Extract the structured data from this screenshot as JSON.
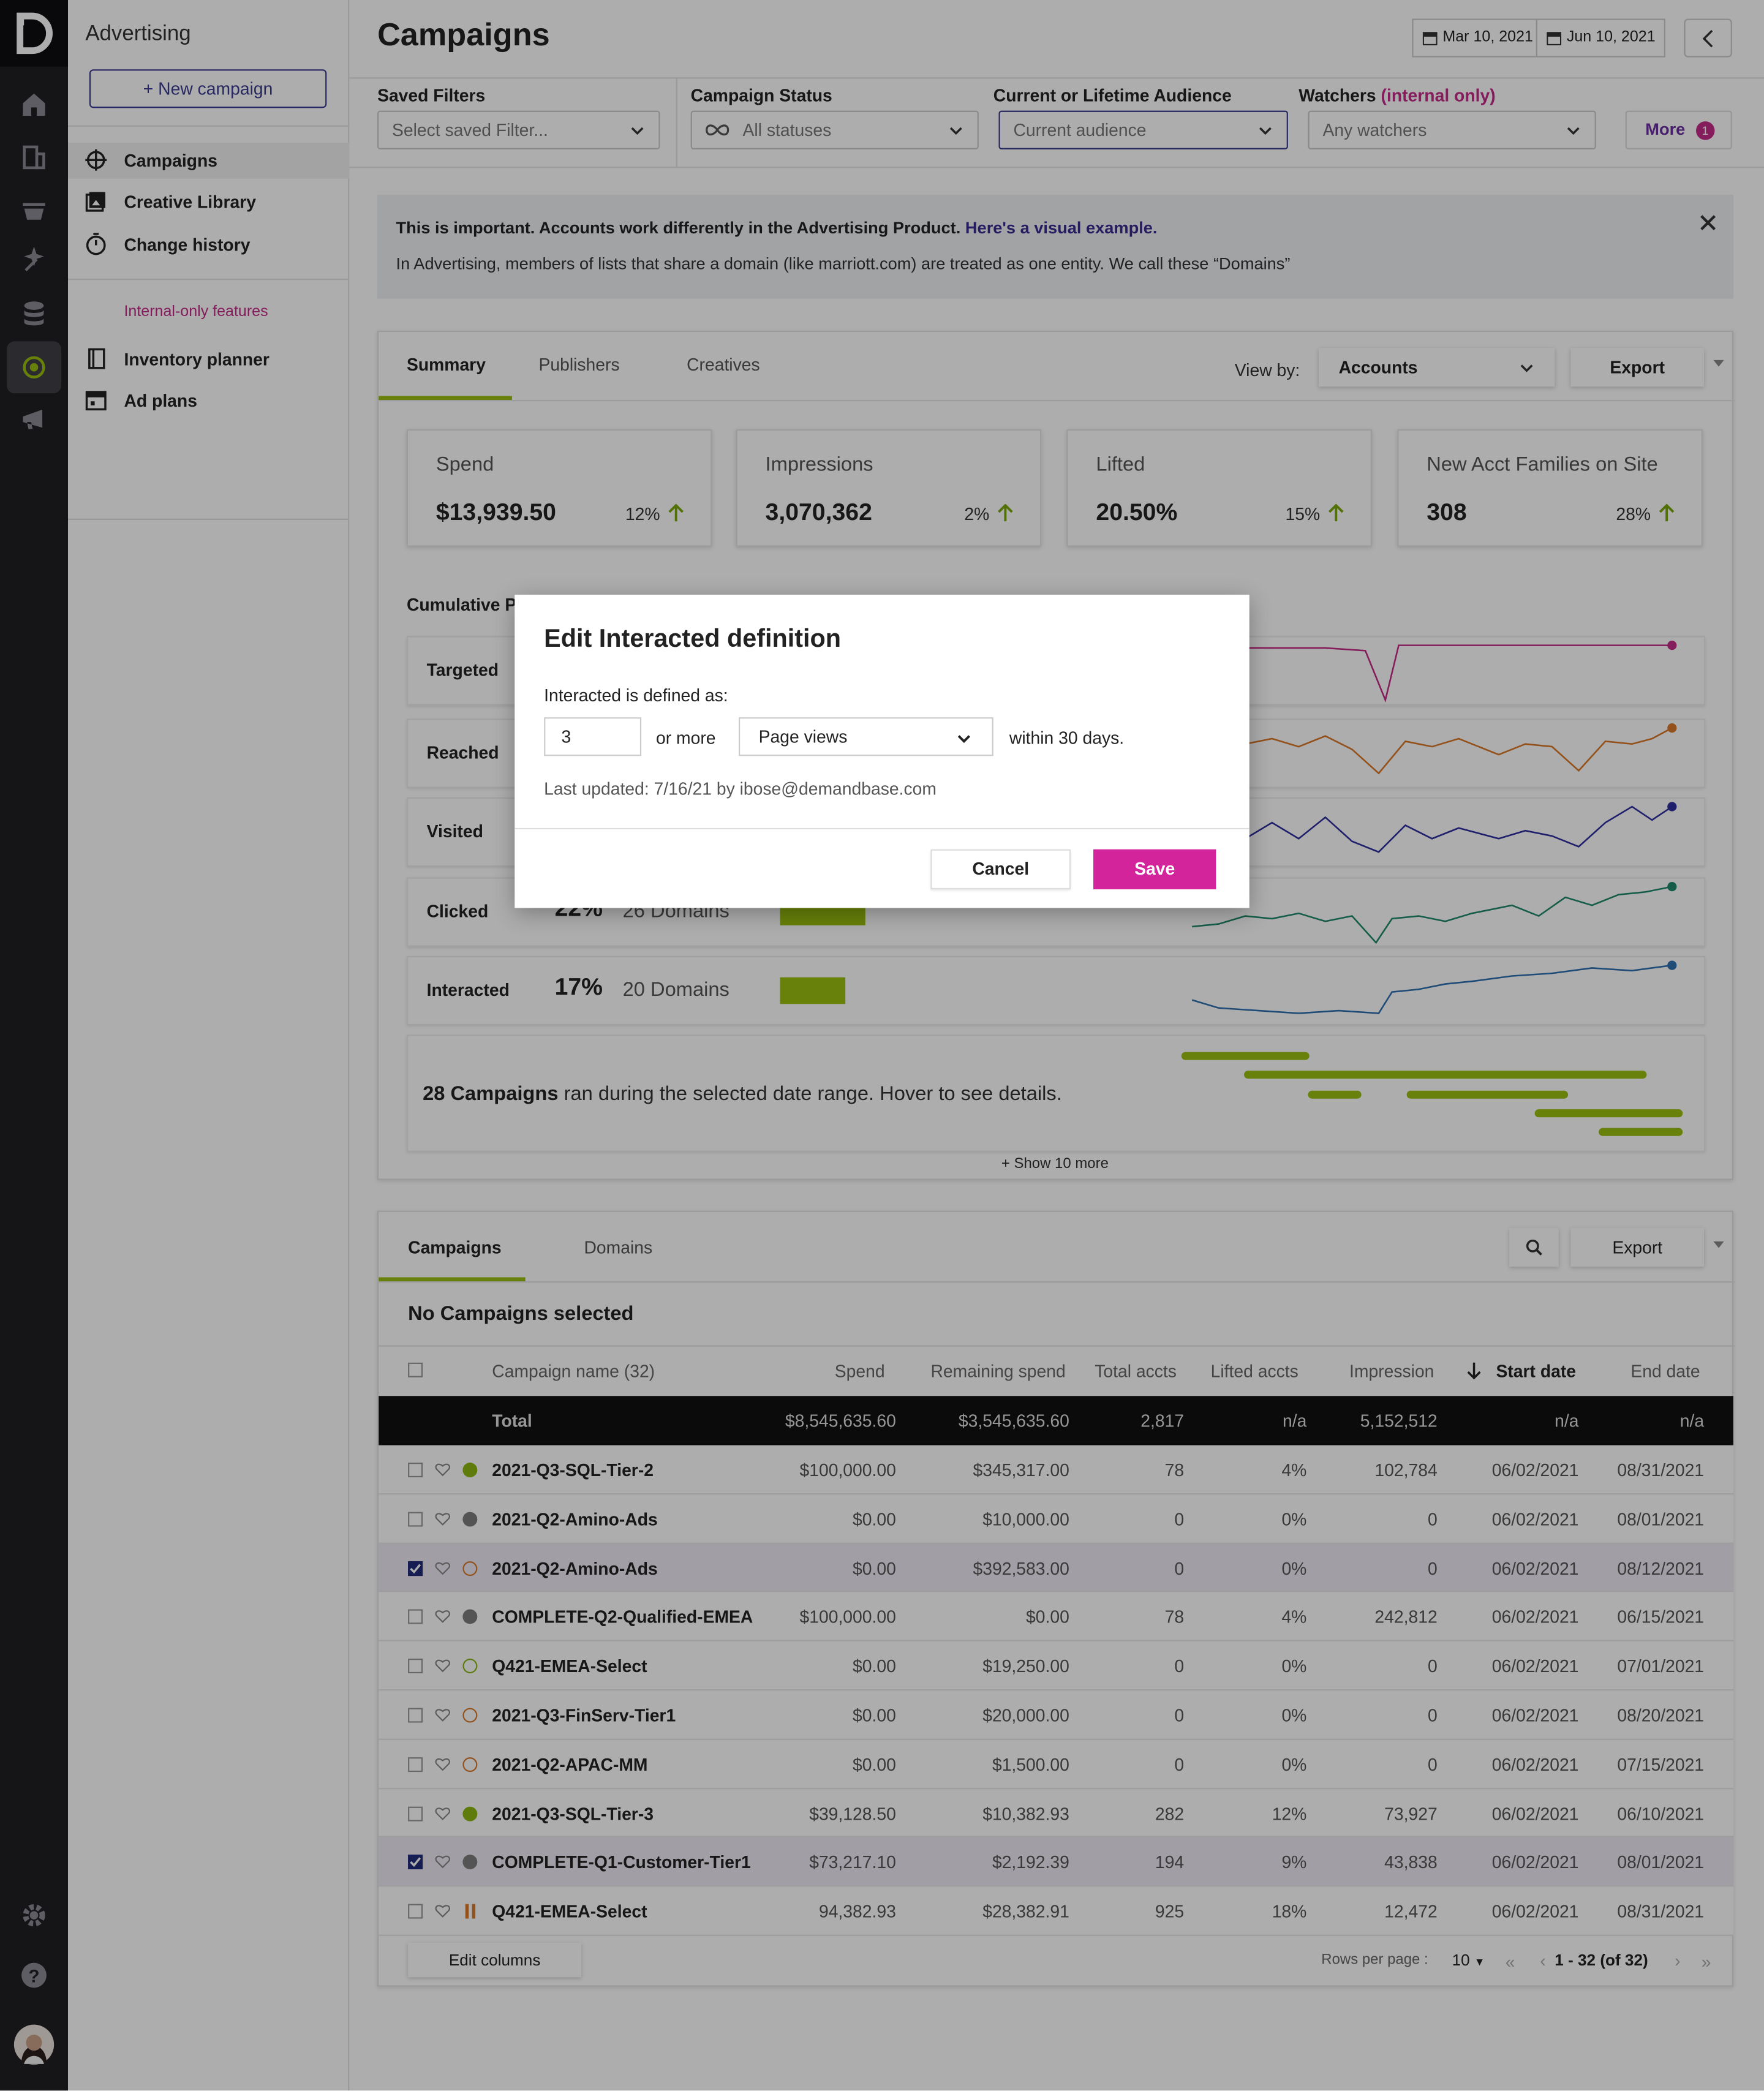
{
  "sidebar": {
    "header": "Advertising",
    "new_campaign": "+ New campaign",
    "items": [
      {
        "label": "Campaigns",
        "icon": "crosshair-icon"
      },
      {
        "label": "Creative Library",
        "icon": "image-library-icon"
      },
      {
        "label": "Change history",
        "icon": "stopwatch-icon"
      }
    ],
    "internal_label": "Internal-only features",
    "internal_items": [
      {
        "label": "Inventory planner",
        "icon": "book-icon"
      },
      {
        "label": "Ad plans",
        "icon": "calendar-icon"
      }
    ]
  },
  "header": {
    "title": "Campaigns",
    "date_start": "Mar 10, 2021",
    "date_end": "Jun 10, 2021"
  },
  "filters": {
    "saved_label": "Saved Filters",
    "saved_placeholder": "Select saved Filter...",
    "status_label": "Campaign Status",
    "status_value": "All statuses",
    "audience_label": "Current or Lifetime Audience",
    "audience_value": "Current audience",
    "watchers_label": "Watchers",
    "watchers_note": "(internal only)",
    "watchers_value": "Any watchers",
    "more_label": "More",
    "more_count": "1"
  },
  "banner": {
    "bold": "This is important. Accounts work differently in the Advertising Product.",
    "link": "Here's a visual example.",
    "body": "In Advertising, members of lists that share a domain (like marriott.com) are treated as one entity. We call these “Domains”"
  },
  "summary": {
    "tabs": [
      "Summary",
      "Publishers",
      "Creatives"
    ],
    "view_by_label": "View by:",
    "view_by_value": "Accounts",
    "export": "Export",
    "kpis": [
      {
        "label": "Spend",
        "value": "$13,939.50",
        "change": "12%"
      },
      {
        "label": "Impressions",
        "value": "3,070,362",
        "change": "2%"
      },
      {
        "label": "Lifted",
        "value": "20.50%",
        "change": "15%"
      },
      {
        "label": "New Acct Families on Site",
        "value": "308",
        "change": "28%"
      }
    ],
    "cumulative_label": "Cumulative P",
    "funnel": [
      {
        "name": "Targeted",
        "pct": "",
        "domains": "",
        "bar": 0,
        "color": "#c42b89"
      },
      {
        "name": "Reached",
        "pct": "",
        "domains": "",
        "bar": 0,
        "color": "#d9782a"
      },
      {
        "name": "Visited",
        "pct": "",
        "domains": "",
        "bar": 0,
        "color": "#2f2fa0"
      },
      {
        "name": "Clicked",
        "pct": "22%",
        "domains": "26 Domains",
        "bar": 0.22,
        "color": "#1f8a6a"
      },
      {
        "name": "Interacted",
        "pct": "17%",
        "domains": "20 Domains",
        "bar": 0.17,
        "color": "#2f6fb0"
      }
    ],
    "campaigns_count": "28 Campaigns",
    "campaigns_text": "ran during the selected date range. Hover to see details.",
    "show_more": "+ Show 10 more"
  },
  "table": {
    "tabs": [
      "Campaigns",
      "Domains"
    ],
    "export": "Export",
    "selection_title": "No Campaigns selected",
    "columns": [
      "Campaign name (32)",
      "Spend",
      "Remaining spend",
      "Total accts",
      "Lifted accts",
      "Impression",
      "Start date",
      "End date"
    ],
    "total": {
      "name": "Total",
      "spend": "$8,545,635.60",
      "remaining": "$3,545,635.60",
      "total_accts": "2,817",
      "lifted": "n/a",
      "impression": "5,152,512",
      "start": "n/a",
      "end": "n/a"
    },
    "rows": [
      {
        "name": "2021-Q3-SQL-Tier-2",
        "spend": "$100,000.00",
        "remaining": "$345,317.00",
        "total_accts": "78",
        "lifted": "4%",
        "impression": "102,784",
        "start": "06/02/2021",
        "end": "08/31/2021",
        "status": "active",
        "checked": false
      },
      {
        "name": "2021-Q2-Amino-Ads",
        "spend": "$0.00",
        "remaining": "$10,000.00",
        "total_accts": "0",
        "lifted": "0%",
        "impression": "0",
        "start": "06/02/2021",
        "end": "08/01/2021",
        "status": "complete",
        "checked": false
      },
      {
        "name": "2021-Q2-Amino-Ads",
        "spend": "$0.00",
        "remaining": "$392,583.00",
        "total_accts": "0",
        "lifted": "0%",
        "impression": "0",
        "start": "06/02/2021",
        "end": "08/12/2021",
        "status": "draft",
        "checked": true
      },
      {
        "name": "COMPLETE-Q2-Qualified-EMEA",
        "spend": "$100,000.00",
        "remaining": "$0.00",
        "total_accts": "78",
        "lifted": "4%",
        "impression": "242,812",
        "start": "06/02/2021",
        "end": "06/15/2021",
        "status": "complete",
        "checked": false
      },
      {
        "name": "Q421-EMEA-Select",
        "spend": "$0.00",
        "remaining": "$19,250.00",
        "total_accts": "0",
        "lifted": "0%",
        "impression": "0",
        "start": "06/02/2021",
        "end": "07/01/2021",
        "status": "scheduled",
        "checked": false
      },
      {
        "name": "2021-Q3-FinServ-Tier1",
        "spend": "$0.00",
        "remaining": "$20,000.00",
        "total_accts": "0",
        "lifted": "0%",
        "impression": "0",
        "start": "06/02/2021",
        "end": "08/20/2021",
        "status": "draft",
        "checked": false
      },
      {
        "name": "2021-Q2-APAC-MM",
        "spend": "$0.00",
        "remaining": "$1,500.00",
        "total_accts": "0",
        "lifted": "0%",
        "impression": "0",
        "start": "06/02/2021",
        "end": "07/15/2021",
        "status": "draft",
        "checked": false
      },
      {
        "name": "2021-Q3-SQL-Tier-3",
        "spend": "$39,128.50",
        "remaining": "$10,382.93",
        "total_accts": "282",
        "lifted": "12%",
        "impression": "73,927",
        "start": "06/02/2021",
        "end": "06/10/2021",
        "status": "active",
        "checked": false
      },
      {
        "name": "COMPLETE-Q1-Customer-Tier1",
        "spend": "$73,217.10",
        "remaining": "$2,192.39",
        "total_accts": "194",
        "lifted": "9%",
        "impression": "43,838",
        "start": "06/02/2021",
        "end": "08/01/2021",
        "status": "complete",
        "checked": true
      },
      {
        "name": "Q421-EMEA-Select",
        "spend": "94,382.93",
        "remaining": "$28,382.91",
        "total_accts": "925",
        "lifted": "18%",
        "impression": "12,472",
        "start": "06/02/2021",
        "end": "08/31/2021",
        "status": "paused",
        "checked": false
      }
    ],
    "edit_columns": "Edit columns",
    "rows_per_page_label": "Rows per page :",
    "rows_per_page": "10",
    "pagination": "1 - 32 (of 32)"
  },
  "modal": {
    "title": "Edit Interacted definition",
    "label": "Interacted is defined as:",
    "count": "3",
    "or_more": "or more",
    "metric": "Page views",
    "within": "within 30 days.",
    "last_updated": "Last updated: 7/16/21 by ibose@demandbase.com",
    "cancel": "Cancel",
    "save": "Save"
  },
  "colors": {
    "accent": "#9abf0f",
    "brand_pink": "#d4249b",
    "link_purple": "#3b3b8f",
    "status_active": "#8db511",
    "status_complete": "#7d7d7d",
    "status_draft": "#d9782a"
  }
}
